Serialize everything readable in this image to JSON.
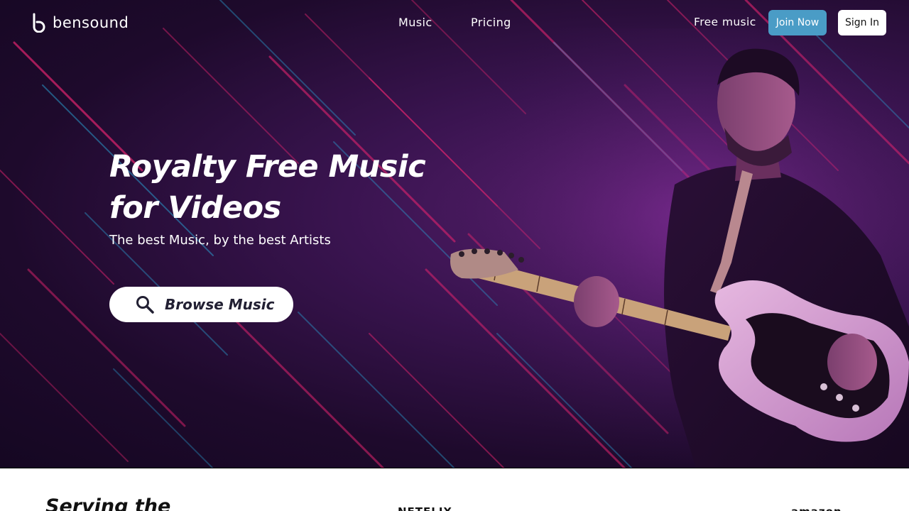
{
  "header": {
    "logo_text": "bensound",
    "nav": {
      "music": "Music",
      "pricing": "Pricing",
      "free_music": "Free music"
    },
    "join_now": "Join Now",
    "sign_in": "Sign In"
  },
  "hero": {
    "title_line1": "Royalty Free Music",
    "title_line2": "for Videos",
    "subtitle": "The best Music, by the best Artists",
    "browse_button": "Browse Music",
    "browse_icon": "search-icon"
  },
  "lower": {
    "serving_heading": "Serving the",
    "brand_logos": [
      "NETFLIX",
      "amazon"
    ]
  },
  "colors": {
    "join_button": "#4a9cc6",
    "hero_background": "#1e0a2c",
    "streak_pink": "#e0246e",
    "streak_blue": "#2aa7d9"
  }
}
